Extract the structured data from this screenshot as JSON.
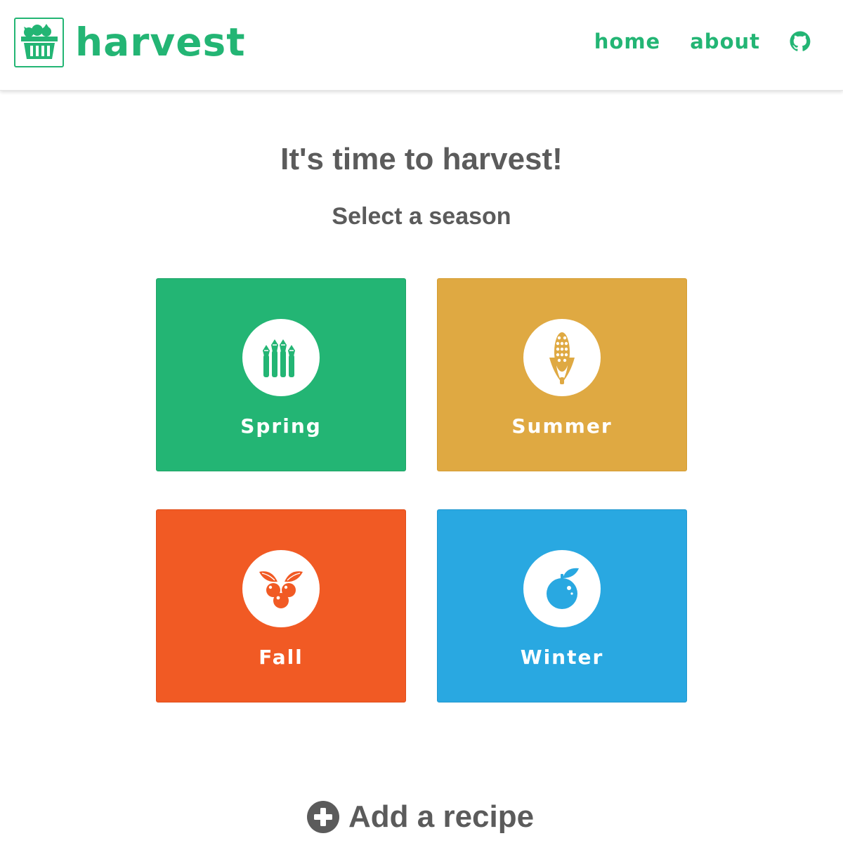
{
  "colors": {
    "brand": "#23b574",
    "spring": "#23b574",
    "summer": "#dfa942",
    "fall": "#f15a24",
    "winter": "#29a8e1",
    "text": "#5b5b5b"
  },
  "header": {
    "logo_icon": "basket-icon",
    "brand": "harvest",
    "nav": {
      "home": "home",
      "about": "about",
      "github_icon": "github-icon"
    }
  },
  "main": {
    "title": "It's time to harvest!",
    "subtitle": "Select a season",
    "seasons": [
      {
        "label": "Spring",
        "icon": "asparagus-icon"
      },
      {
        "label": "Summer",
        "icon": "corn-icon"
      },
      {
        "label": "Fall",
        "icon": "berries-icon"
      },
      {
        "label": "Winter",
        "icon": "orange-icon"
      }
    ],
    "add_recipe": {
      "label": "Add a recipe",
      "icon": "plus-circle-icon"
    }
  }
}
